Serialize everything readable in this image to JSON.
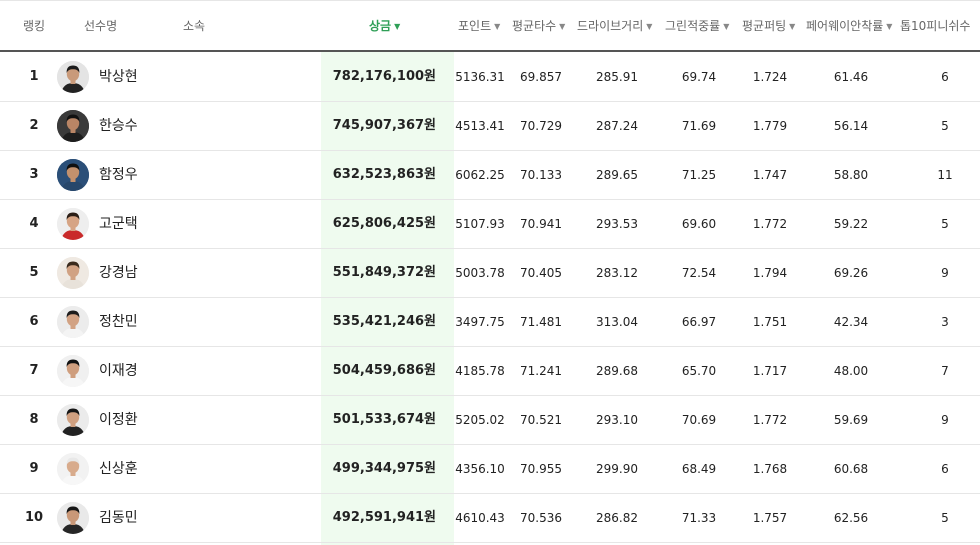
{
  "header": {
    "rank": "랭킹",
    "player": "선수명",
    "affiliation": "소속",
    "prize": "상금",
    "points": "포인트",
    "avg_score": "평균타수",
    "driving_distance": "드라이브거리",
    "gir": "그린적중률",
    "avg_putts": "평균퍼팅",
    "fairway": "페어웨이안착률",
    "top10": "톱10피니쉬수",
    "sort_arrow": "▼"
  },
  "colors": {
    "accent": "#2f9f57",
    "prize_column_bg": "#effbef"
  },
  "rows": [
    {
      "rank": "1",
      "name": "박상현",
      "prize": "782,176,100원",
      "points": "5136.31",
      "avg_score": "69.857",
      "drive": "285.91",
      "gir": "69.74",
      "putts": "1.724",
      "fairway": "61.46",
      "top10": "6",
      "avatar": {
        "bg": "#e4e4e4",
        "hair": "#1b1b1b",
        "shirt": "#222222",
        "skin": "#c99a7a"
      }
    },
    {
      "rank": "2",
      "name": "한승수",
      "prize": "745,907,367원",
      "points": "4513.41",
      "avg_score": "70.729",
      "drive": "287.24",
      "gir": "71.69",
      "putts": "1.779",
      "fairway": "56.14",
      "top10": "5",
      "avatar": {
        "bg": "#3a3a3a",
        "hair": "#111111",
        "shirt": "#1d1d1d",
        "skin": "#b98565"
      }
    },
    {
      "rank": "3",
      "name": "함정우",
      "prize": "632,523,863원",
      "points": "6062.25",
      "avg_score": "70.133",
      "drive": "289.65",
      "gir": "71.25",
      "putts": "1.747",
      "fairway": "58.80",
      "top10": "11",
      "avatar": {
        "bg": "#2b4f78",
        "hair": "#101010",
        "shirt": "#27476b",
        "skin": "#c3916d"
      }
    },
    {
      "rank": "4",
      "name": "고군택",
      "prize": "625,806,425원",
      "points": "5107.93",
      "avg_score": "70.941",
      "drive": "293.53",
      "gir": "69.60",
      "putts": "1.772",
      "fairway": "59.22",
      "top10": "5",
      "avatar": {
        "bg": "#eeeeee",
        "hair": "#2a1e16",
        "shirt": "#c92a2a",
        "skin": "#d6a484"
      }
    },
    {
      "rank": "5",
      "name": "강경남",
      "prize": "551,849,372원",
      "points": "5003.78",
      "avg_score": "70.405",
      "drive": "283.12",
      "gir": "72.54",
      "putts": "1.794",
      "fairway": "69.26",
      "top10": "9",
      "avatar": {
        "bg": "#efe9e2",
        "hair": "#3a2a1c",
        "shirt": "#e8e2da",
        "skin": "#d1a283"
      }
    },
    {
      "rank": "6",
      "name": "정찬민",
      "prize": "535,421,246원",
      "points": "3497.75",
      "avg_score": "71.481",
      "drive": "313.04",
      "gir": "66.97",
      "putts": "1.751",
      "fairway": "42.34",
      "top10": "3",
      "avatar": {
        "bg": "#ececec",
        "hair": "#1c1c1c",
        "shirt": "#f4f4f4",
        "skin": "#d2a283"
      }
    },
    {
      "rank": "7",
      "name": "이재경",
      "prize": "504,459,686원",
      "points": "4185.78",
      "avg_score": "71.241",
      "drive": "289.68",
      "gir": "65.70",
      "putts": "1.717",
      "fairway": "48.00",
      "top10": "7",
      "avatar": {
        "bg": "#f0f0f0",
        "hair": "#111111",
        "shirt": "#f6f6f6",
        "skin": "#cf9e7e"
      }
    },
    {
      "rank": "8",
      "name": "이정환",
      "prize": "501,533,674원",
      "points": "5205.02",
      "avg_score": "70.521",
      "drive": "293.10",
      "gir": "70.69",
      "putts": "1.772",
      "fairway": "59.69",
      "top10": "9",
      "avatar": {
        "bg": "#ebebeb",
        "hair": "#161616",
        "shirt": "#222222",
        "skin": "#d0a080"
      }
    },
    {
      "rank": "9",
      "name": "신상훈",
      "prize": "499,344,975원",
      "points": "4356.10",
      "avg_score": "70.955",
      "drive": "299.90",
      "gir": "68.49",
      "putts": "1.768",
      "fairway": "60.68",
      "top10": "6",
      "avatar": {
        "bg": "#f2f2f2",
        "hair": "#e8e8e8",
        "shirt": "#f7f7f7",
        "skin": "#d8ab8c"
      }
    },
    {
      "rank": "10",
      "name": "김동민",
      "prize": "492,591,941원",
      "points": "4610.43",
      "avg_score": "70.536",
      "drive": "286.82",
      "gir": "71.33",
      "putts": "1.757",
      "fairway": "62.56",
      "top10": "5",
      "avatar": {
        "bg": "#e9e9e9",
        "hair": "#151515",
        "shirt": "#262626",
        "skin": "#c99878"
      }
    }
  ]
}
